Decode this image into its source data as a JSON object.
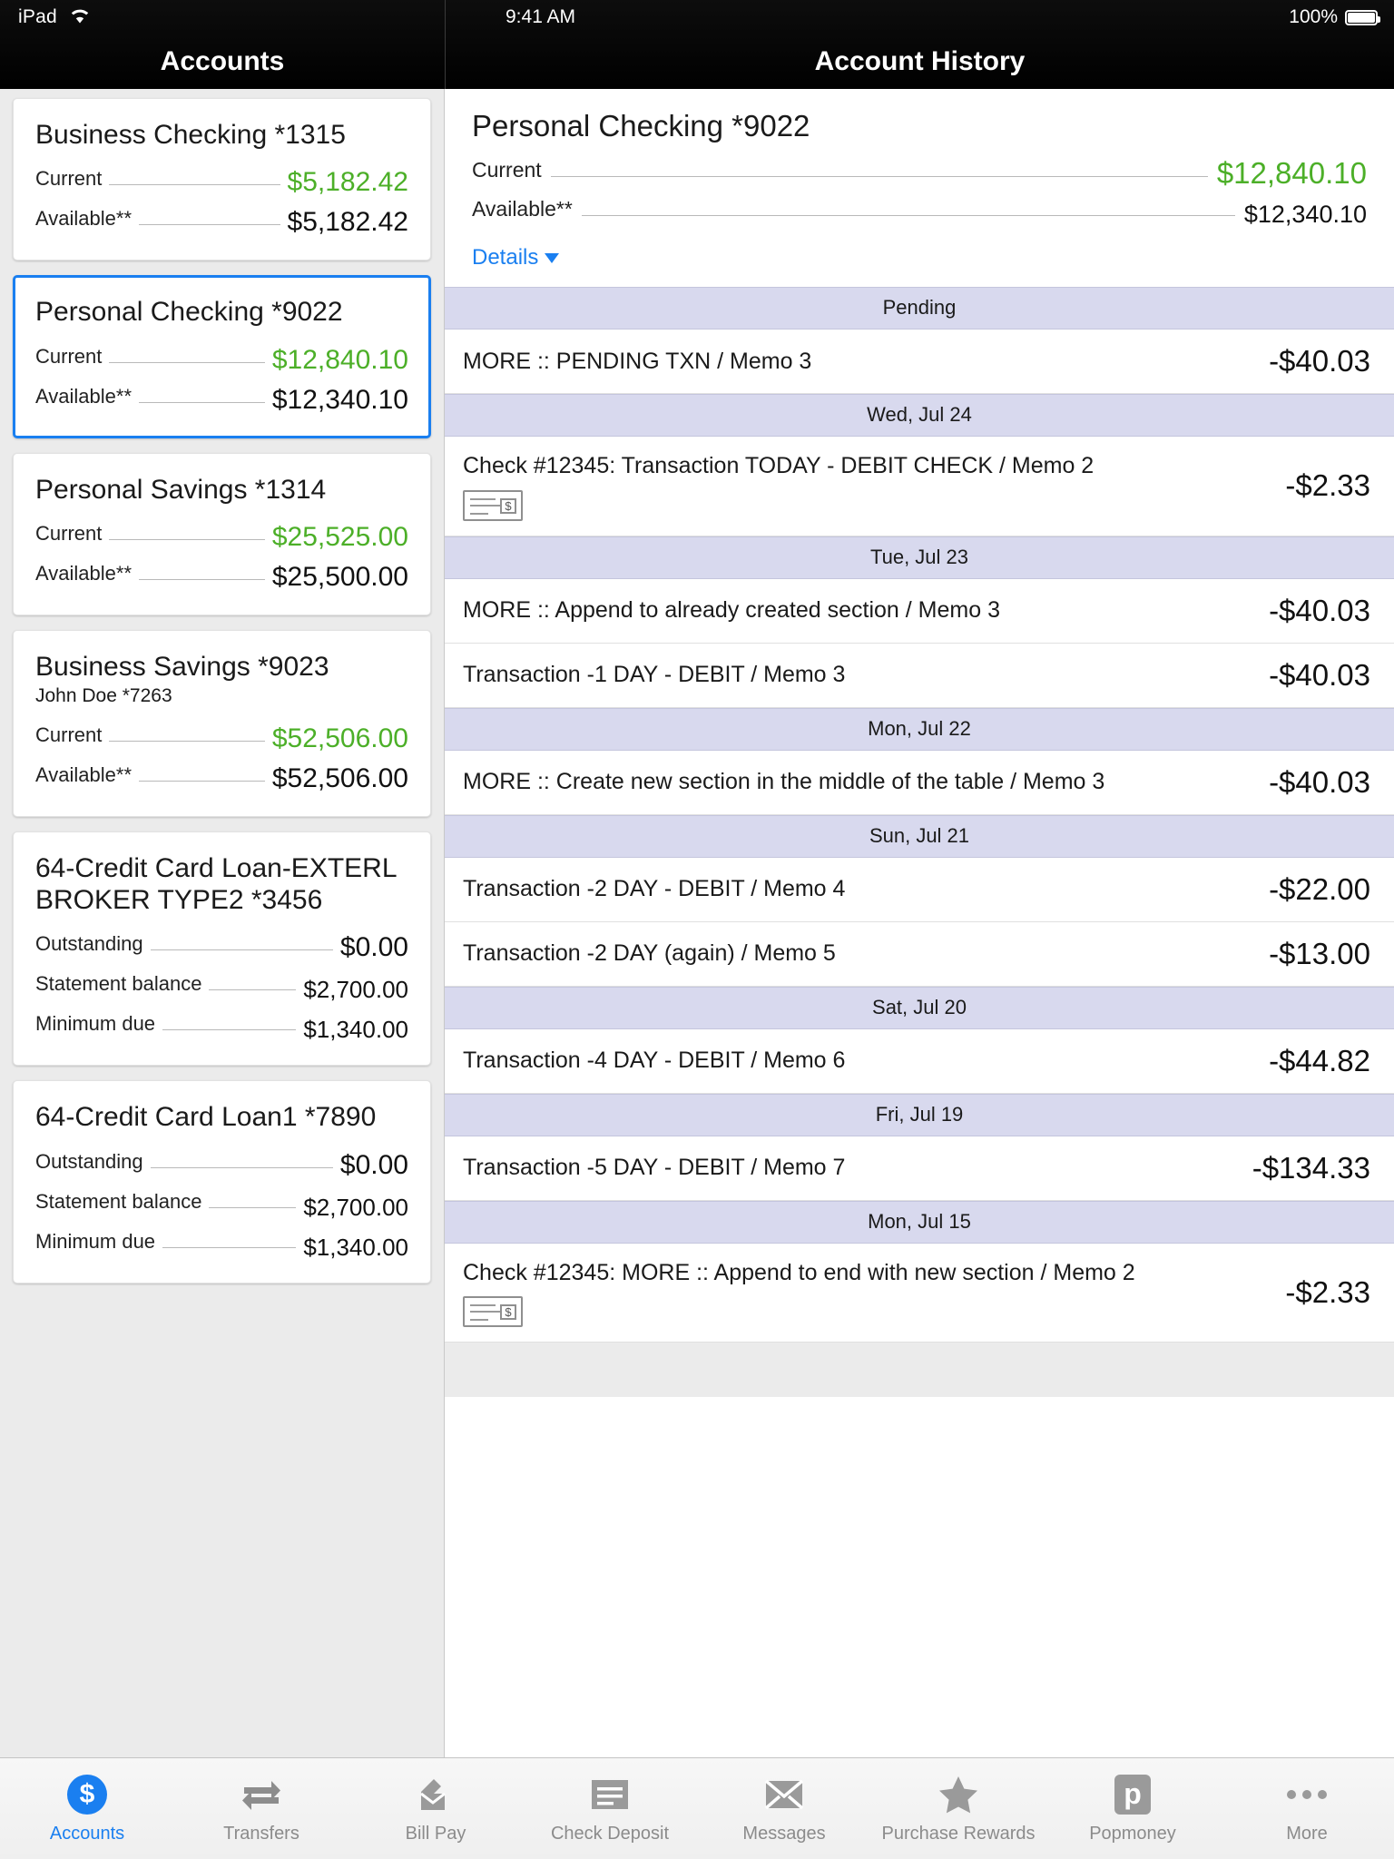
{
  "status_bar": {
    "device_label": "iPad",
    "wifi_icon": "wifi-icon",
    "time": "9:41 AM",
    "battery_percent": "100%",
    "battery_icon": "battery-icon"
  },
  "left_pane": {
    "nav_title": "Accounts",
    "accounts": [
      {
        "title": "Business Checking *1315",
        "subtitle": "",
        "selected": false,
        "rows": [
          {
            "label": "Current",
            "value": "$5,182.42",
            "green": true
          },
          {
            "label": "Available**",
            "value": "$5,182.42",
            "green": false
          }
        ]
      },
      {
        "title": "Personal Checking *9022",
        "subtitle": "",
        "selected": true,
        "rows": [
          {
            "label": "Current",
            "value": "$12,840.10",
            "green": true
          },
          {
            "label": "Available**",
            "value": "$12,340.10",
            "green": false
          }
        ]
      },
      {
        "title": "Personal Savings *1314",
        "subtitle": "",
        "selected": false,
        "rows": [
          {
            "label": "Current",
            "value": "$25,525.00",
            "green": true
          },
          {
            "label": "Available**",
            "value": "$25,500.00",
            "green": false
          }
        ]
      },
      {
        "title": "Business Savings *9023",
        "subtitle": "John Doe *7263",
        "selected": false,
        "rows": [
          {
            "label": "Current",
            "value": "$52,506.00",
            "green": true
          },
          {
            "label": "Available**",
            "value": "$52,506.00",
            "green": false
          }
        ]
      },
      {
        "title": "64-Credit Card Loan-EXTERL BROKER TYPE2 *3456",
        "subtitle": "",
        "selected": false,
        "rows": [
          {
            "label": "Outstanding",
            "value": "$0.00",
            "green": false
          },
          {
            "label": "Statement balance",
            "value": "$2,700.00",
            "green": false,
            "small": true
          },
          {
            "label": "Minimum due",
            "value": "$1,340.00",
            "green": false,
            "small": true
          }
        ]
      },
      {
        "title": "64-Credit Card Loan1 *7890",
        "subtitle": "",
        "selected": false,
        "rows": [
          {
            "label": "Outstanding",
            "value": "$0.00",
            "green": false
          },
          {
            "label": "Statement balance",
            "value": "$2,700.00",
            "green": false,
            "small": true
          },
          {
            "label": "Minimum due",
            "value": "$1,340.00",
            "green": false,
            "small": true
          }
        ]
      }
    ]
  },
  "right_pane": {
    "nav_title": "Account History",
    "account_title": "Personal Checking *9022",
    "summary_rows": [
      {
        "label": "Current",
        "value": "$12,840.10",
        "green": true
      },
      {
        "label": "Available**",
        "value": "$12,340.10",
        "green": false
      }
    ],
    "details_label": "Details",
    "details_caret_icon": "chevron-down-icon",
    "sections": [
      {
        "header": "Pending",
        "transactions": [
          {
            "description": "MORE :: PENDING TXN / Memo 3",
            "amount": "-$40.03",
            "check_image": false
          }
        ]
      },
      {
        "header": "Wed, Jul 24",
        "transactions": [
          {
            "description": "Check #12345: Transaction TODAY - DEBIT CHECK / Memo 2",
            "amount": "-$2.33",
            "check_image": true
          }
        ]
      },
      {
        "header": "Tue, Jul 23",
        "transactions": [
          {
            "description": "MORE :: Append to already created section / Memo 3",
            "amount": "-$40.03",
            "check_image": false
          },
          {
            "description": "Transaction -1 DAY - DEBIT / Memo 3",
            "amount": "-$40.03",
            "check_image": false
          }
        ]
      },
      {
        "header": "Mon, Jul 22",
        "transactions": [
          {
            "description": "MORE :: Create new section in the middle of the table / Memo 3",
            "amount": "-$40.03",
            "check_image": false
          }
        ]
      },
      {
        "header": "Sun, Jul 21",
        "transactions": [
          {
            "description": "Transaction -2 DAY - DEBIT / Memo 4",
            "amount": "-$22.00",
            "check_image": false
          },
          {
            "description": "Transaction -2 DAY (again) / Memo 5",
            "amount": "-$13.00",
            "check_image": false
          }
        ]
      },
      {
        "header": "Sat, Jul 20",
        "transactions": [
          {
            "description": "Transaction -4 DAY - DEBIT / Memo 6",
            "amount": "-$44.82",
            "check_image": false
          }
        ]
      },
      {
        "header": "Fri, Jul 19",
        "transactions": [
          {
            "description": "Transaction -5 DAY - DEBIT / Memo 7",
            "amount": "-$134.33",
            "check_image": false
          }
        ]
      },
      {
        "header": "Mon, Jul 15",
        "transactions": [
          {
            "description": "Check #12345: MORE :: Append to end with new section / Memo 2",
            "amount": "-$2.33",
            "check_image": true
          }
        ]
      }
    ]
  },
  "tab_bar": {
    "items": [
      {
        "label": "Accounts",
        "icon": "dollar-circle-icon",
        "active": true
      },
      {
        "label": "Transfers",
        "icon": "transfer-arrows-icon",
        "active": false
      },
      {
        "label": "Bill Pay",
        "icon": "envelope-pencil-icon",
        "active": false
      },
      {
        "label": "Check Deposit",
        "icon": "check-lines-icon",
        "active": false
      },
      {
        "label": "Messages",
        "icon": "envelope-icon",
        "active": false
      },
      {
        "label": "Purchase Rewards",
        "icon": "star-icon",
        "active": false
      },
      {
        "label": "Popmoney",
        "icon": "popmoney-p-icon",
        "active": false
      },
      {
        "label": "More",
        "icon": "ellipsis-icon",
        "active": false
      }
    ]
  },
  "colors": {
    "accent_blue": "#1a7ff0",
    "positive_green": "#4caf28",
    "section_header_bg": "#d8d9ee"
  }
}
